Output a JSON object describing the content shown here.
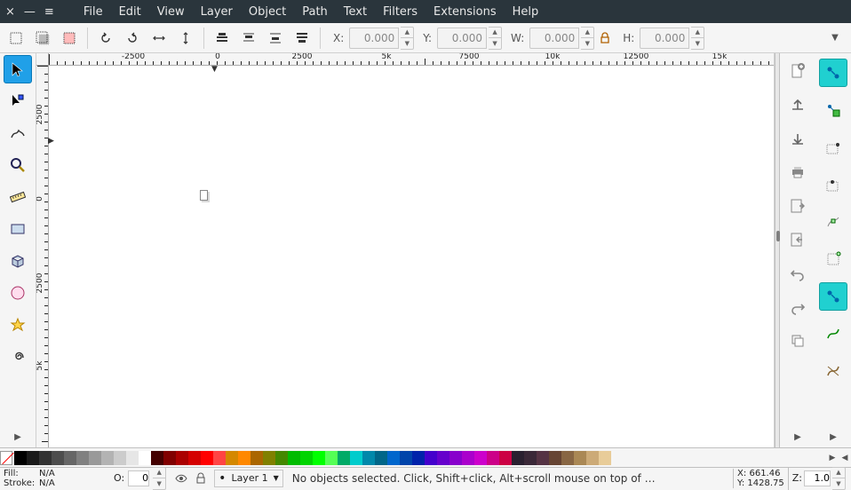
{
  "window_controls": {
    "close": "×",
    "minimize": "—",
    "menu": "≡"
  },
  "menu": [
    "File",
    "Edit",
    "View",
    "Layer",
    "Object",
    "Path",
    "Text",
    "Filters",
    "Extensions",
    "Help"
  ],
  "toolbar": {
    "x_label": "X:",
    "x_value": "0.000",
    "y_label": "Y:",
    "y_value": "0.000",
    "w_label": "W:",
    "w_value": "0.000",
    "h_label": "H:",
    "h_value": "0.000"
  },
  "ruler_h": [
    {
      "pos": 95,
      "label": "-2500"
    },
    {
      "pos": 190,
      "label": "0"
    },
    {
      "pos": 285,
      "label": "2500"
    },
    {
      "pos": 380,
      "label": "5k"
    },
    {
      "pos": 473,
      "label": "7500"
    },
    {
      "pos": 567,
      "label": "10k"
    },
    {
      "pos": 661,
      "label": "12500"
    },
    {
      "pos": 755,
      "label": "15k"
    }
  ],
  "ruler_v": [
    {
      "pos": 55,
      "label": "2500"
    },
    {
      "pos": 150,
      "label": "0"
    },
    {
      "pos": 245,
      "label": "2500"
    },
    {
      "pos": 338,
      "label": "5k"
    }
  ],
  "palette_colors": [
    "#000000",
    "#1a1a1a",
    "#333333",
    "#4d4d4d",
    "#666666",
    "#808080",
    "#999999",
    "#b3b3b3",
    "#cccccc",
    "#e6e6e6",
    "#ffffff",
    "#440000",
    "#800000",
    "#aa0000",
    "#d40000",
    "#ff0000",
    "#ff4444",
    "#d48800",
    "#ff8800",
    "#aa6600",
    "#808000",
    "#448800",
    "#00bb00",
    "#00d400",
    "#00ff00",
    "#55ff55",
    "#00aa66",
    "#00cccc",
    "#0088aa",
    "#006688",
    "#0066cc",
    "#0044aa",
    "#0022aa",
    "#4400cc",
    "#6600cc",
    "#8800cc",
    "#aa00cc",
    "#cc00cc",
    "#cc0088",
    "#cc0044",
    "#2a2030",
    "#3a2838",
    "#553344",
    "#664433",
    "#886644",
    "#aa8855",
    "#ccaa77",
    "#e8cc99"
  ],
  "status": {
    "fill_label": "Fill:",
    "fill_value": "N/A",
    "stroke_label": "Stroke:",
    "stroke_value": "N/A",
    "opacity_label": "O:",
    "opacity_value": "0",
    "layer": "Layer 1",
    "hint": "No objects selected. Click, Shift+click, Alt+scroll mouse on top of …",
    "x_label": "X:",
    "x_value": "661.46",
    "y_label": "Y:",
    "y_value": "1428.75",
    "z_label": "Z:",
    "z_value": "1.0"
  }
}
